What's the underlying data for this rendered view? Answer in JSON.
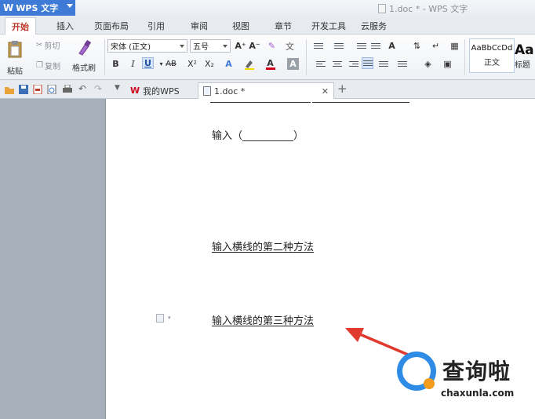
{
  "titlebar": {
    "app_name": "WPS 文字",
    "app_logo": "W",
    "doc_title": "1.doc * - WPS 文字"
  },
  "tabs": [
    {
      "label": "开始",
      "active": true
    },
    {
      "label": "插入",
      "active": false
    },
    {
      "label": "页面布局",
      "active": false
    },
    {
      "label": "引用",
      "active": false
    },
    {
      "label": "审阅",
      "active": false
    },
    {
      "label": "视图",
      "active": false
    },
    {
      "label": "章节",
      "active": false
    },
    {
      "label": "开发工具",
      "active": false
    },
    {
      "label": "云服务",
      "active": false
    }
  ],
  "ribbon": {
    "paste": "粘贴",
    "cut": "剪切",
    "copy": "复制",
    "format_painter": "格式刷",
    "font_name": "宋体 (正文)",
    "font_size": "五号",
    "bold": "B",
    "italic": "I",
    "underline": "U",
    "strike": "AB",
    "superscript": "X²",
    "subscript": "X₂",
    "font_color": "A",
    "grow_font": "A⁺",
    "shrink_font": "A⁻",
    "style_normal_sample": "AaBbCcDd",
    "style_normal": "正文",
    "style_heading_sample": "AaI",
    "style_heading": "标题"
  },
  "doctabs": [
    {
      "label": "我的WPS",
      "active": false
    },
    {
      "label": "1.doc *",
      "active": true
    }
  ],
  "document": {
    "line1": "输入（__________）",
    "line2": "输入横线的第二种方法",
    "line3": "输入横线的第三种方法"
  },
  "colors": {
    "accent": "#3d7bd6",
    "arrow": "#e03a2f",
    "wm_blue": "#2e8be6",
    "wm_orange": "#f29b1d"
  },
  "watermark": {
    "text": "查询啦",
    "url": "chaxunla.com"
  }
}
